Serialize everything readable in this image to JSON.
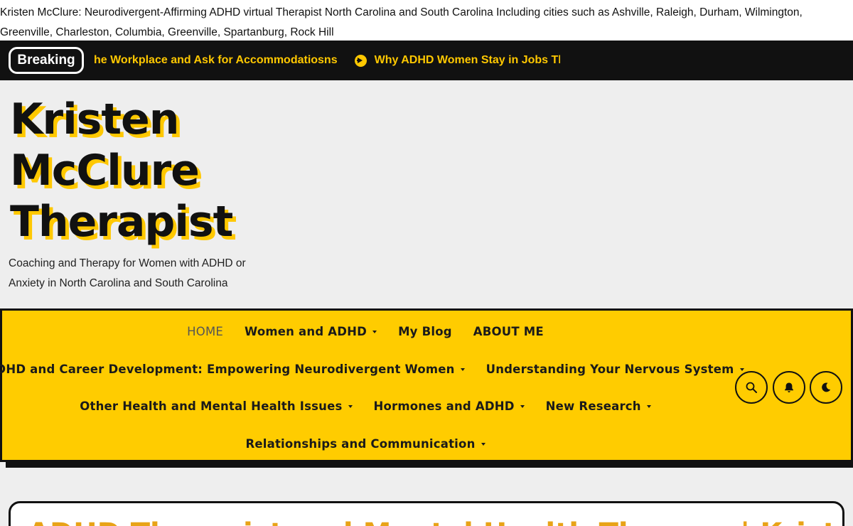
{
  "header": {
    "site_description": "Kristen McClure: Neurodivergent-Affirming ADHD virtual Therapist North Carolina and South Carolina Including cities such as Ashville, Raleigh, Durham, Wilmington, Greenville, Charleston, Columbia, Greenville, Spartanburg, Rock Hill"
  },
  "breaking": {
    "label": "Breaking",
    "items": [
      "he Workplace and Ask for Accommodatiosns",
      "Why ADHD Women Stay in Jobs They H"
    ]
  },
  "branding": {
    "title_lines": [
      "Kristen",
      "McClure",
      "Therapist"
    ],
    "tagline": "Coaching and Therapy for Women with ADHD or Anxiety in North Carolina and South Carolina"
  },
  "nav": {
    "row1": [
      {
        "label": "HOME",
        "has_dropdown": false,
        "active": true
      },
      {
        "label": "Women and ADHD",
        "has_dropdown": true
      },
      {
        "label": "My Blog",
        "has_dropdown": false
      },
      {
        "label": "ABOUT ME",
        "has_dropdown": false
      }
    ],
    "row2": [
      {
        "label": "ADHD and Career Development: Empowering Neurodivergent Women",
        "has_dropdown": true
      },
      {
        "label": "Understanding Your Nervous System",
        "has_dropdown": true
      }
    ],
    "row3": [
      {
        "label": "Other Health and Mental Health Issues",
        "has_dropdown": true
      },
      {
        "label": "Hormones and ADHD",
        "has_dropdown": true
      },
      {
        "label": "New Research",
        "has_dropdown": true
      }
    ],
    "row4": [
      {
        "label": "Relationships and Communication",
        "has_dropdown": true
      }
    ],
    "icons": [
      "search-icon",
      "bell-icon",
      "moon-icon"
    ]
  },
  "post": {
    "title": "ADHD Therapist and Mental Health Therapy | Kristen McClure"
  },
  "colors": {
    "accent": "#ffcc00",
    "dark": "#111111",
    "ticker_text": "#ffc800",
    "post_title": "#e8a317"
  }
}
